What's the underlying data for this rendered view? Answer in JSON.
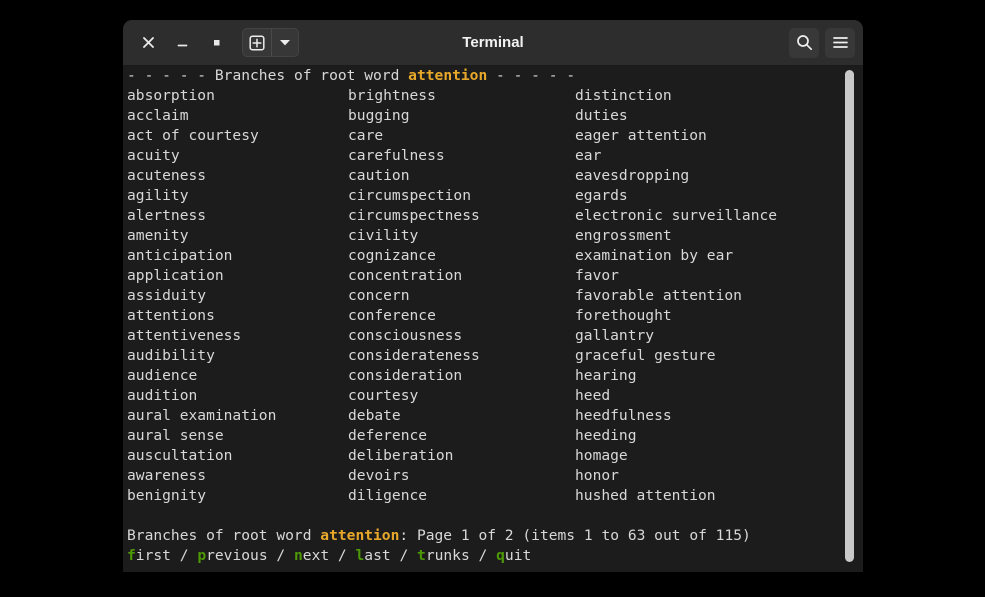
{
  "window": {
    "title": "Terminal",
    "controls": [
      {
        "name": "close-button",
        "glyph": "x"
      },
      {
        "name": "minimize-button",
        "glyph": "_"
      },
      {
        "name": "maximize-button",
        "glyph": "square"
      }
    ],
    "new_tab_label": "+",
    "new_tab_dropdown_label": "▾",
    "search_icon": "search-icon",
    "menu_icon": "hamburger-menu-icon"
  },
  "colors": {
    "background": "#1c1c1c",
    "titlebar": "#2d2d2d",
    "foreground": "#d8d8d8",
    "keyword": "#e8a92b",
    "command_key": "#4e9a06",
    "scrollbar": "#c9c9c9"
  },
  "terminal": {
    "header": {
      "dashes_left": "- - - - - ",
      "prefix": "Branches of root word ",
      "root_word": "attention",
      "dashes_right": " - - - - -"
    },
    "columns": [
      [
        "absorption",
        "acclaim",
        "act of courtesy",
        "acuity",
        "acuteness",
        "agility",
        "alertness",
        "amenity",
        "anticipation",
        "application",
        "assiduity",
        "attentions",
        "attentiveness",
        "audibility",
        "audience",
        "audition",
        "aural examination",
        "aural sense",
        "auscultation",
        "awareness",
        "benignity"
      ],
      [
        "brightness",
        "bugging",
        "care",
        "carefulness",
        "caution",
        "circumspection",
        "circumspectness",
        "civility",
        "cognizance",
        "concentration",
        "concern",
        "conference",
        "consciousness",
        "considerateness",
        "consideration",
        "courtesy",
        "debate",
        "deference",
        "deliberation",
        "devoirs",
        "diligence"
      ],
      [
        "distinction",
        "duties",
        "eager attention",
        "ear",
        "eavesdropping",
        "egards",
        "electronic surveillance",
        "engrossment",
        "examination by ear",
        "favor",
        "favorable attention",
        "forethought",
        "gallantry",
        "graceful gesture",
        "hearing",
        "heed",
        "heedfulness",
        "heeding",
        "homage",
        "honor",
        "hushed attention"
      ]
    ],
    "status": {
      "prefix": "Branches of root word ",
      "root_word": "attention",
      "suffix": ": Page 1 of 2 (items 1 to 63 out of 115)",
      "page_current": 1,
      "page_total": 2,
      "items_from": 1,
      "items_to": 63,
      "items_total": 115
    },
    "commands": [
      {
        "key": "f",
        "rest": "irst"
      },
      {
        "key": "p",
        "rest": "revious"
      },
      {
        "key": "n",
        "rest": "ext"
      },
      {
        "key": "l",
        "rest": "ast"
      },
      {
        "key": "t",
        "rest": "runks"
      },
      {
        "key": "q",
        "rest": "uit"
      }
    ],
    "command_separator": " / "
  }
}
